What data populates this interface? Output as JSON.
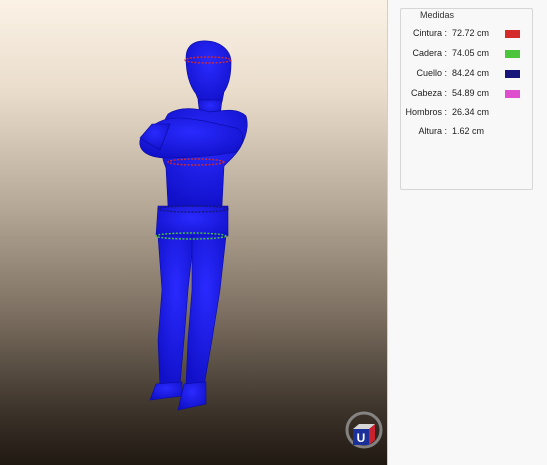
{
  "panel": {
    "title": "Medidas",
    "measurements": [
      {
        "label": "Cintura :",
        "value": "72.72 cm",
        "color": "#d42a2a"
      },
      {
        "label": "Cadera :",
        "value": "74.05 cm",
        "color": "#4cc53c"
      },
      {
        "label": "Cuello :",
        "value": "84.24 cm",
        "color": "#16167a"
      },
      {
        "label": "Cabeza :",
        "value": "54.89 cm",
        "color": "#e04ed0"
      },
      {
        "label": "Hombros :",
        "value": "26.34 cm",
        "color": ""
      },
      {
        "label": "Altura :",
        "value": "1.62 cm",
        "color": ""
      }
    ]
  },
  "viewport": {
    "model_color": "#1818e8",
    "background_top": "#fbf2e6",
    "background_bottom": "#201912"
  },
  "logo": {
    "letter": "U",
    "icon": "university-logo-icon"
  }
}
